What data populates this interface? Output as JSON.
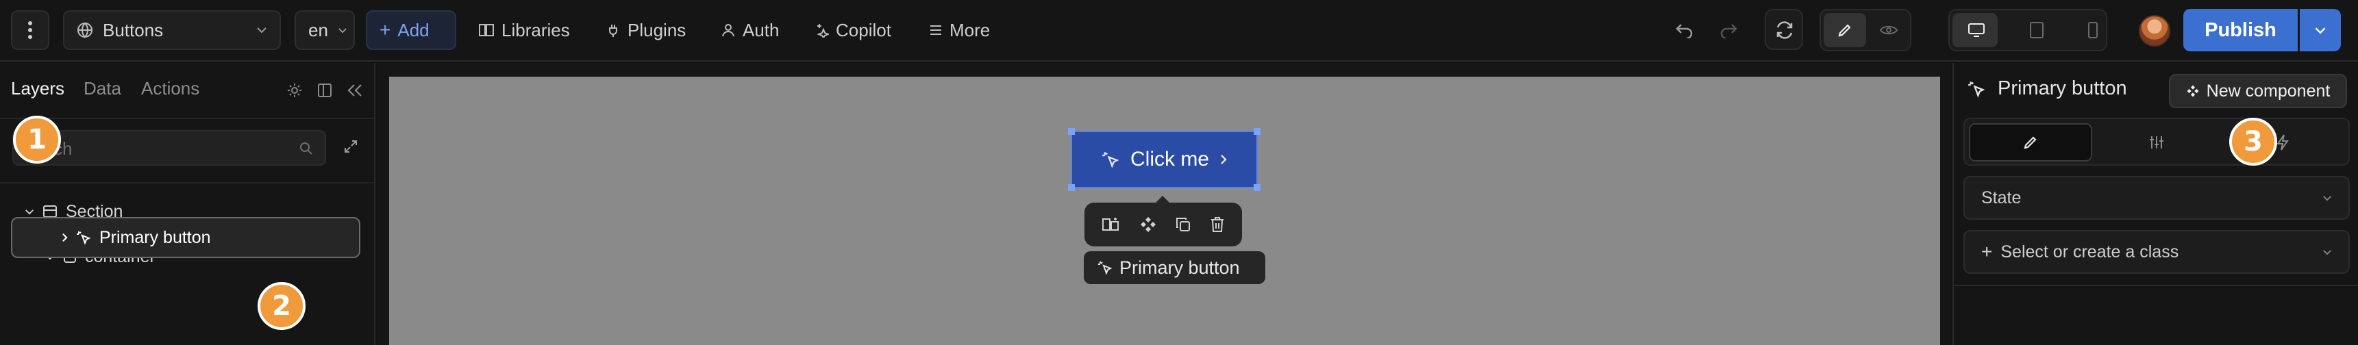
{
  "toolbar": {
    "page_select": "Buttons",
    "locale_select": "en",
    "add_label": "Add",
    "libraries_label": "Libraries",
    "plugins_label": "Plugins",
    "auth_label": "Auth",
    "copilot_label": "Copilot",
    "more_label": "More",
    "publish_label": "Publish"
  },
  "left_panel": {
    "tabs": [
      "Layers",
      "Data",
      "Actions"
    ],
    "active_tab": "Layers",
    "search_value": "ch",
    "tree": {
      "section_label": "Section",
      "container_label": "container",
      "selected_label": "Primary button"
    }
  },
  "canvas": {
    "button_label": "Click me",
    "selection_label": "Primary button"
  },
  "right_panel": {
    "title": "Primary button",
    "new_component_label": "New component",
    "state_label": "State",
    "class_select_label": "Select or create a class"
  },
  "badges": [
    "1",
    "2",
    "3"
  ],
  "colors": {
    "accent": "#3b6fd0",
    "badge": "#f09a3c",
    "canvas_button": "#2a4ca6"
  }
}
